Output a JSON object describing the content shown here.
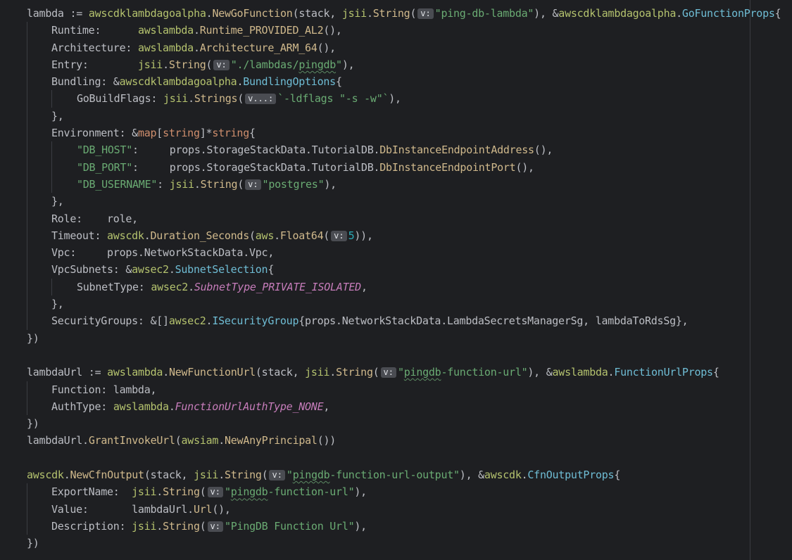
{
  "colors": {
    "background": "#1e1f22",
    "package": "#b4c26e",
    "function": "#d0b98c",
    "type": "#6fbdd5",
    "string": "#6aab73",
    "keyword": "#cf8e6d",
    "number": "#2aacb8",
    "constant": "#c77dbb",
    "plain": "#bcbec4",
    "inlay_hint_bg": "#4a4c52"
  },
  "code_lines": [
    {
      "indent": 0,
      "tokens": [
        [
          "plain",
          "lambda"
        ],
        [
          "op",
          " := "
        ],
        [
          "pkg",
          "awscdklambdagoalpha"
        ],
        [
          "op",
          "."
        ],
        [
          "fn",
          "NewGoFunction"
        ],
        [
          "op",
          "(stack, "
        ],
        [
          "pkg",
          "jsii"
        ],
        [
          "op",
          "."
        ],
        [
          "fn",
          "String"
        ],
        [
          "op",
          "("
        ],
        [
          "hint",
          "v:"
        ],
        [
          "str",
          "\"ping-db-lambda\""
        ],
        [
          "op",
          "), &"
        ],
        [
          "pkg",
          "awscdklambdagoalpha"
        ],
        [
          "op",
          "."
        ],
        [
          "type",
          "GoFunctionProps"
        ],
        [
          "op",
          "{"
        ]
      ]
    },
    {
      "indent": 1,
      "tokens": [
        [
          "plain",
          "Runtime:      "
        ],
        [
          "pkg",
          "awslambda"
        ],
        [
          "op",
          "."
        ],
        [
          "fn",
          "Runtime_PROVIDED_AL2"
        ],
        [
          "op",
          "(),"
        ]
      ]
    },
    {
      "indent": 1,
      "tokens": [
        [
          "plain",
          "Architecture: "
        ],
        [
          "pkg",
          "awslambda"
        ],
        [
          "op",
          "."
        ],
        [
          "fn",
          "Architecture_ARM_64"
        ],
        [
          "op",
          "(),"
        ]
      ]
    },
    {
      "indent": 1,
      "tokens": [
        [
          "plain",
          "Entry:        "
        ],
        [
          "pkg",
          "jsii"
        ],
        [
          "op",
          "."
        ],
        [
          "fn",
          "String"
        ],
        [
          "op",
          "("
        ],
        [
          "hint",
          "v:"
        ],
        [
          "str",
          "\"./lambdas/"
        ],
        [
          "strsq",
          "pingdb"
        ],
        [
          "str",
          "\""
        ],
        [
          "op",
          "),"
        ]
      ]
    },
    {
      "indent": 1,
      "tokens": [
        [
          "plain",
          "Bundling: &"
        ],
        [
          "pkg",
          "awscdklambdagoalpha"
        ],
        [
          "op",
          "."
        ],
        [
          "type",
          "BundlingOptions"
        ],
        [
          "op",
          "{"
        ]
      ]
    },
    {
      "indent": 2,
      "tokens": [
        [
          "plain",
          "GoBuildFlags: "
        ],
        [
          "pkg",
          "jsii"
        ],
        [
          "op",
          "."
        ],
        [
          "fn",
          "Strings"
        ],
        [
          "op",
          "("
        ],
        [
          "hint",
          "v...:"
        ],
        [
          "str",
          "`-ldflags \"-s -w\"`"
        ],
        [
          "op",
          "),"
        ]
      ]
    },
    {
      "indent": 1,
      "tokens": [
        [
          "op",
          "},"
        ]
      ]
    },
    {
      "indent": 1,
      "tokens": [
        [
          "plain",
          "Environment: &"
        ],
        [
          "kw",
          "map"
        ],
        [
          "op",
          "["
        ],
        [
          "kw",
          "string"
        ],
        [
          "op",
          "]*"
        ],
        [
          "kw",
          "string"
        ],
        [
          "op",
          "{"
        ]
      ]
    },
    {
      "indent": 2,
      "tokens": [
        [
          "str",
          "\"DB_HOST\""
        ],
        [
          "op",
          ":     "
        ],
        [
          "plain",
          "props.StorageStackData.TutorialDB."
        ],
        [
          "fn",
          "DbInstanceEndpointAddress"
        ],
        [
          "op",
          "(),"
        ]
      ]
    },
    {
      "indent": 2,
      "tokens": [
        [
          "str",
          "\"DB_PORT\""
        ],
        [
          "op",
          ":     "
        ],
        [
          "plain",
          "props.StorageStackData.TutorialDB."
        ],
        [
          "fn",
          "DbInstanceEndpointPort"
        ],
        [
          "op",
          "(),"
        ]
      ]
    },
    {
      "indent": 2,
      "tokens": [
        [
          "str",
          "\"DB_USERNAME\""
        ],
        [
          "op",
          ": "
        ],
        [
          "pkg",
          "jsii"
        ],
        [
          "op",
          "."
        ],
        [
          "fn",
          "String"
        ],
        [
          "op",
          "("
        ],
        [
          "hint",
          "v:"
        ],
        [
          "str",
          "\"postgres\""
        ],
        [
          "op",
          "),"
        ]
      ]
    },
    {
      "indent": 1,
      "tokens": [
        [
          "op",
          "},"
        ]
      ]
    },
    {
      "indent": 1,
      "tokens": [
        [
          "plain",
          "Role:    role"
        ],
        [
          "op",
          ","
        ]
      ]
    },
    {
      "indent": 1,
      "tokens": [
        [
          "plain",
          "Timeout: "
        ],
        [
          "pkg",
          "awscdk"
        ],
        [
          "op",
          "."
        ],
        [
          "fn",
          "Duration_Seconds"
        ],
        [
          "op",
          "("
        ],
        [
          "pkg",
          "aws"
        ],
        [
          "op",
          "."
        ],
        [
          "fn",
          "Float64"
        ],
        [
          "op",
          "("
        ],
        [
          "hint",
          "v:"
        ],
        [
          "num",
          "5"
        ],
        [
          "op",
          ")),"
        ]
      ]
    },
    {
      "indent": 1,
      "tokens": [
        [
          "plain",
          "Vpc:     props.NetworkStackData.Vpc"
        ],
        [
          "op",
          ","
        ]
      ]
    },
    {
      "indent": 1,
      "tokens": [
        [
          "plain",
          "VpcSubnets: &"
        ],
        [
          "pkg",
          "awsec2"
        ],
        [
          "op",
          "."
        ],
        [
          "type",
          "SubnetSelection"
        ],
        [
          "op",
          "{"
        ]
      ]
    },
    {
      "indent": 2,
      "tokens": [
        [
          "plain",
          "SubnetType: "
        ],
        [
          "pkg",
          "awsec2"
        ],
        [
          "op",
          "."
        ],
        [
          "const",
          "SubnetType_PRIVATE_ISOLATED"
        ],
        [
          "op",
          ","
        ]
      ]
    },
    {
      "indent": 1,
      "tokens": [
        [
          "op",
          "},"
        ]
      ]
    },
    {
      "indent": 1,
      "tokens": [
        [
          "plain",
          "SecurityGroups: &[]"
        ],
        [
          "pkg",
          "awsec2"
        ],
        [
          "op",
          "."
        ],
        [
          "type",
          "ISecurityGroup"
        ],
        [
          "op",
          "{"
        ],
        [
          "plain",
          "props.NetworkStackData.LambdaSecretsManagerSg, lambdaToRdsSg"
        ],
        [
          "op",
          "},"
        ]
      ]
    },
    {
      "indent": 0,
      "tokens": [
        [
          "op",
          "})"
        ]
      ]
    },
    {
      "indent": 0,
      "tokens": []
    },
    {
      "indent": 0,
      "tokens": [
        [
          "plain",
          "lambdaUrl"
        ],
        [
          "op",
          " := "
        ],
        [
          "pkg",
          "awslambda"
        ],
        [
          "op",
          "."
        ],
        [
          "fn",
          "NewFunctionUrl"
        ],
        [
          "op",
          "(stack, "
        ],
        [
          "pkg",
          "jsii"
        ],
        [
          "op",
          "."
        ],
        [
          "fn",
          "String"
        ],
        [
          "op",
          "("
        ],
        [
          "hint",
          "v:"
        ],
        [
          "str",
          "\""
        ],
        [
          "strsq",
          "pingdb"
        ],
        [
          "str",
          "-function-url\""
        ],
        [
          "op",
          "), &"
        ],
        [
          "pkg",
          "awslambda"
        ],
        [
          "op",
          "."
        ],
        [
          "type",
          "FunctionUrlProps"
        ],
        [
          "op",
          "{"
        ]
      ]
    },
    {
      "indent": 1,
      "tokens": [
        [
          "plain",
          "Function: lambda"
        ],
        [
          "op",
          ","
        ]
      ]
    },
    {
      "indent": 1,
      "tokens": [
        [
          "plain",
          "AuthType: "
        ],
        [
          "pkg",
          "awslambda"
        ],
        [
          "op",
          "."
        ],
        [
          "const",
          "FunctionUrlAuthType_NONE"
        ],
        [
          "op",
          ","
        ]
      ]
    },
    {
      "indent": 0,
      "tokens": [
        [
          "op",
          "})"
        ]
      ]
    },
    {
      "indent": 0,
      "tokens": [
        [
          "plain",
          "lambdaUrl."
        ],
        [
          "fn",
          "GrantInvokeUrl"
        ],
        [
          "op",
          "("
        ],
        [
          "pkg",
          "awsiam"
        ],
        [
          "op",
          "."
        ],
        [
          "fn",
          "NewAnyPrincipal"
        ],
        [
          "op",
          "())"
        ]
      ]
    },
    {
      "indent": 0,
      "tokens": []
    },
    {
      "indent": 0,
      "tokens": [
        [
          "pkg",
          "awscdk"
        ],
        [
          "op",
          "."
        ],
        [
          "fn",
          "NewCfnOutput"
        ],
        [
          "op",
          "(stack, "
        ],
        [
          "pkg",
          "jsii"
        ],
        [
          "op",
          "."
        ],
        [
          "fn",
          "String"
        ],
        [
          "op",
          "("
        ],
        [
          "hint",
          "v:"
        ],
        [
          "str",
          "\""
        ],
        [
          "strsq",
          "pingdb"
        ],
        [
          "str",
          "-function-url-output\""
        ],
        [
          "op",
          "), &"
        ],
        [
          "pkg",
          "awscdk"
        ],
        [
          "op",
          "."
        ],
        [
          "type",
          "CfnOutputProps"
        ],
        [
          "op",
          "{"
        ]
      ]
    },
    {
      "indent": 1,
      "tokens": [
        [
          "plain",
          "ExportName:  "
        ],
        [
          "pkg",
          "jsii"
        ],
        [
          "op",
          "."
        ],
        [
          "fn",
          "String"
        ],
        [
          "op",
          "("
        ],
        [
          "hint",
          "v:"
        ],
        [
          "str",
          "\""
        ],
        [
          "strsq",
          "pingdb"
        ],
        [
          "str",
          "-function-url\""
        ],
        [
          "op",
          "),"
        ]
      ]
    },
    {
      "indent": 1,
      "tokens": [
        [
          "plain",
          "Value:       lambdaUrl."
        ],
        [
          "fn",
          "Url"
        ],
        [
          "op",
          "(),"
        ]
      ]
    },
    {
      "indent": 1,
      "tokens": [
        [
          "plain",
          "Description: "
        ],
        [
          "pkg",
          "jsii"
        ],
        [
          "op",
          "."
        ],
        [
          "fn",
          "String"
        ],
        [
          "op",
          "("
        ],
        [
          "hint",
          "v:"
        ],
        [
          "str",
          "\"PingDB Function Url\""
        ],
        [
          "op",
          "),"
        ]
      ]
    },
    {
      "indent": 0,
      "tokens": [
        [
          "op",
          "})"
        ]
      ]
    }
  ]
}
